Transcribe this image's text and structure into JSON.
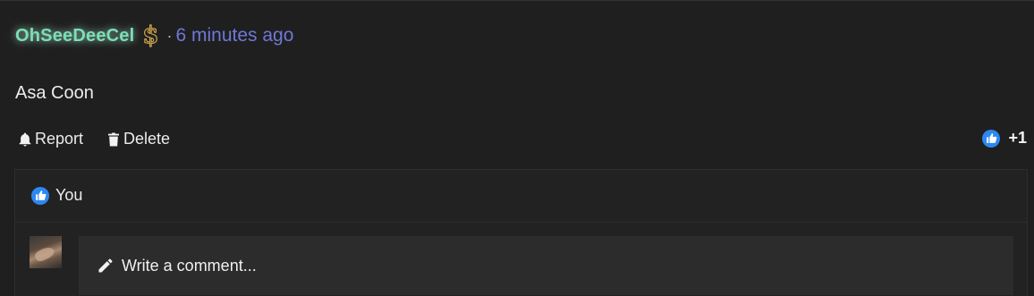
{
  "post": {
    "author": "OhSeeDeeCel",
    "badge_icon": "dollar-sign-icon",
    "badge_glyph": "$",
    "separator": "·",
    "timestamp": "6 minutes ago",
    "body": "Asa Coon"
  },
  "actions": {
    "report_label": "Report",
    "delete_label": "Delete"
  },
  "likes": {
    "count": "+1"
  },
  "likers": {
    "label": "You"
  },
  "comment": {
    "placeholder": "Write a comment..."
  },
  "colors": {
    "author": "#7bdfb6",
    "timestamp": "#6f78d6",
    "badge": "#c9a24b",
    "like": "#2d88f0",
    "background": "#1f1f1f"
  }
}
